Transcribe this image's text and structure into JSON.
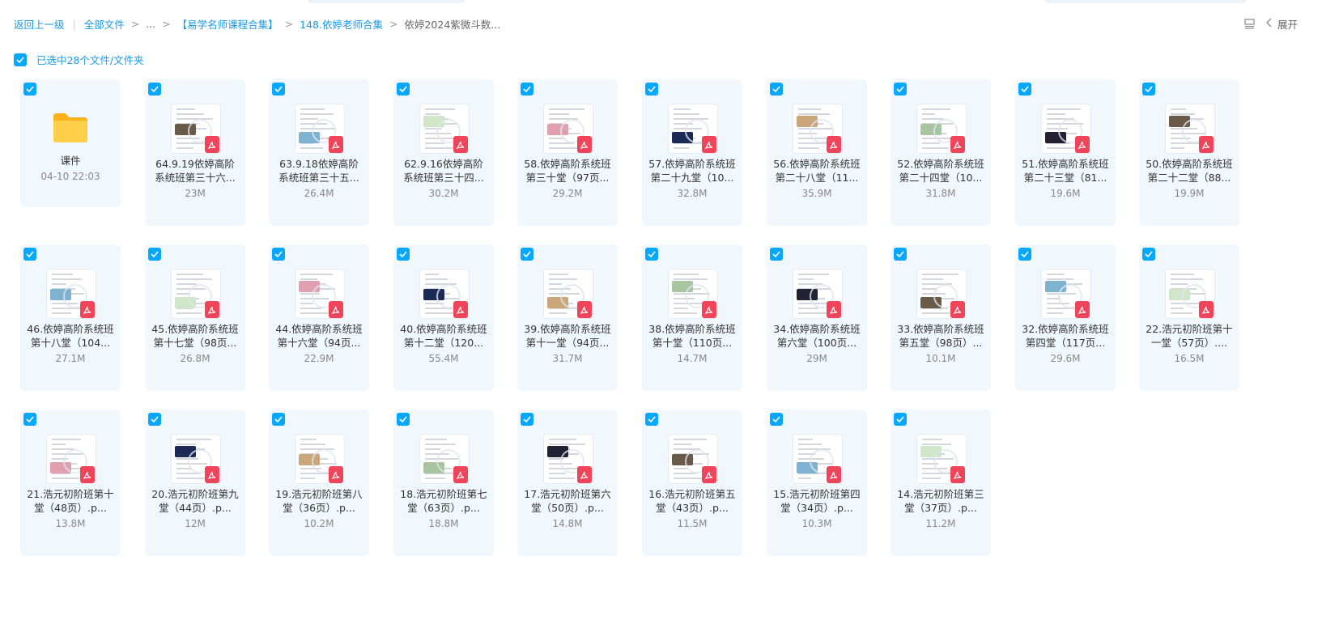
{
  "breadcrumb": {
    "back": "返回上一级",
    "all_files": "全部文件",
    "ellipsis": "...",
    "level1": "【易学名师课程合集】",
    "level2": "148.依婷老师合集",
    "current": "依婷2024紫微斗数..."
  },
  "topbar": {
    "expand_label": "展开",
    "view_icon": "list-view-icon",
    "chevron_icon": "chevron-left-icon"
  },
  "selection": {
    "label": "已选中28个文件/文件夹",
    "checked": true
  },
  "colors": {
    "accent": "#06a7ff",
    "tile_bg": "#f0f7fd",
    "pdf": "#f0445a",
    "folder": "#ffc53d"
  },
  "files": [
    {
      "type": "folder",
      "name": "课件",
      "meta": "04-10 22:03"
    },
    {
      "type": "pdf",
      "name": "64.9.19依婷高阶系统班第三十六...",
      "meta": "23M"
    },
    {
      "type": "pdf",
      "name": "63.9.18依婷高阶系统班第三十五...",
      "meta": "26.4M"
    },
    {
      "type": "pdf",
      "name": "62.9.16依婷高阶系统班第三十四...",
      "meta": "30.2M"
    },
    {
      "type": "pdf",
      "name": "58.依婷高阶系统班第三十堂（97页...",
      "meta": "29.2M"
    },
    {
      "type": "pdf",
      "name": "57.依婷高阶系统班第二十九堂（10...",
      "meta": "32.8M"
    },
    {
      "type": "pdf",
      "name": "56.依婷高阶系统班第二十八堂（11...",
      "meta": "35.9M"
    },
    {
      "type": "pdf",
      "name": "52.依婷高阶系统班第二十四堂（10...",
      "meta": "31.8M"
    },
    {
      "type": "pdf",
      "name": "51.依婷高阶系统班第二十三堂（81...",
      "meta": "19.6M"
    },
    {
      "type": "pdf",
      "name": "50.依婷高阶系统班第二十二堂（88...",
      "meta": "19.9M"
    },
    {
      "type": "pdf",
      "name": "46.依婷高阶系统班第十八堂（104...",
      "meta": "27.1M"
    },
    {
      "type": "pdf",
      "name": "45.依婷高阶系统班第十七堂（98页...",
      "meta": "26.8M"
    },
    {
      "type": "pdf",
      "name": "44.依婷高阶系统班第十六堂（94页...",
      "meta": "22.9M"
    },
    {
      "type": "pdf",
      "name": "40.依婷高阶系统班第十二堂（120...",
      "meta": "55.4M"
    },
    {
      "type": "pdf",
      "name": "39.依婷高阶系统班第十一堂（94页...",
      "meta": "31.7M"
    },
    {
      "type": "pdf",
      "name": "38.依婷高阶系统班第十堂（110页...",
      "meta": "14.7M"
    },
    {
      "type": "pdf",
      "name": "34.依婷高阶系统班第六堂（100页...",
      "meta": "29M"
    },
    {
      "type": "pdf",
      "name": "33.依婷高阶系统班第五堂（98页）...",
      "meta": "10.1M"
    },
    {
      "type": "pdf",
      "name": "32.依婷高阶系统班第四堂（117页...",
      "meta": "29.6M"
    },
    {
      "type": "pdf",
      "name": "22.浩元初阶班第十一堂（57页）....",
      "meta": "16.5M"
    },
    {
      "type": "pdf",
      "name": "21.浩元初阶班第十堂（48页）.p...",
      "meta": "13.8M"
    },
    {
      "type": "pdf",
      "name": "20.浩元初阶班第九堂（44页）.p...",
      "meta": "12M"
    },
    {
      "type": "pdf",
      "name": "19.浩元初阶班第八堂（36页）.p...",
      "meta": "10.2M"
    },
    {
      "type": "pdf",
      "name": "18.浩元初阶班第七堂（63页）.p...",
      "meta": "18.8M"
    },
    {
      "type": "pdf",
      "name": "17.浩元初阶班第六堂（50页）.p...",
      "meta": "14.8M"
    },
    {
      "type": "pdf",
      "name": "16.浩元初阶班第五堂（43页）.p...",
      "meta": "11.5M"
    },
    {
      "type": "pdf",
      "name": "15.浩元初阶班第四堂（34页）.p...",
      "meta": "10.3M"
    },
    {
      "type": "pdf",
      "name": "14.浩元初阶班第三堂（37页）.p...",
      "meta": "11.2M"
    }
  ]
}
